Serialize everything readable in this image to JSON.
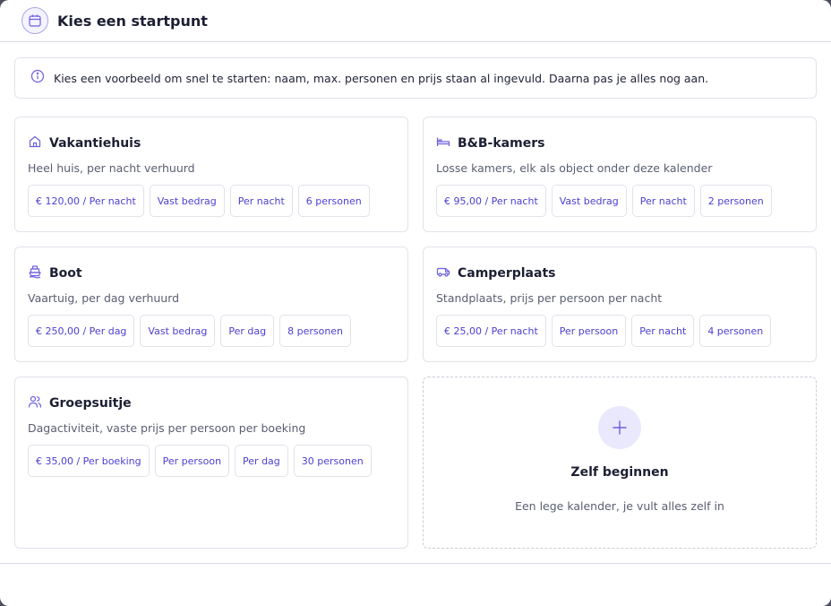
{
  "dialog": {
    "title": "Kies een startpunt",
    "title_icon": "calendar-icon",
    "info_icon": "info-icon",
    "info_text": "Kies een voorbeeld om snel te starten: naam, max. personen en prijs staan al ingevuld. Daarna pas je alles nog aan."
  },
  "templates": [
    {
      "icon": "house-icon",
      "title": "Vakantiehuis",
      "description": "Heel huis, per nacht verhuurd",
      "chips": [
        "€ 120,00 / Per nacht",
        "Vast bedrag",
        "Per nacht",
        "6 personen"
      ]
    },
    {
      "icon": "bed-icon",
      "title": "B&B-kamers",
      "description": "Losse kamers, elk als object onder deze kalender",
      "chips": [
        "€ 95,00 / Per nacht",
        "Vast bedrag",
        "Per nacht",
        "2 personen"
      ]
    },
    {
      "icon": "boat-icon",
      "title": "Boot",
      "description": "Vaartuig, per dag verhuurd",
      "chips": [
        "€ 250,00 / Per dag",
        "Vast bedrag",
        "Per dag",
        "8 personen"
      ]
    },
    {
      "icon": "camper-icon",
      "title": "Camperplaats",
      "description": "Standplaats, prijs per persoon per nacht",
      "chips": [
        "€ 25,00 / Per nacht",
        "Per persoon",
        "Per nacht",
        "4 personen"
      ]
    },
    {
      "icon": "group-icon",
      "title": "Groepsuitje",
      "description": "Dagactiviteit, vaste prijs per persoon per boeking",
      "chips": [
        "€ 35,00 / Per boeking",
        "Per persoon",
        "Per dag",
        "30 personen"
      ]
    }
  ],
  "custom": {
    "icon": "plus-icon",
    "title": "Zelf beginnen",
    "description": "Een lege kalender, je vult alles zelf in"
  },
  "colors": {
    "accent": "#4b3fd0",
    "accent_light": "#e9e8fd",
    "border": "#e1e3ea"
  }
}
